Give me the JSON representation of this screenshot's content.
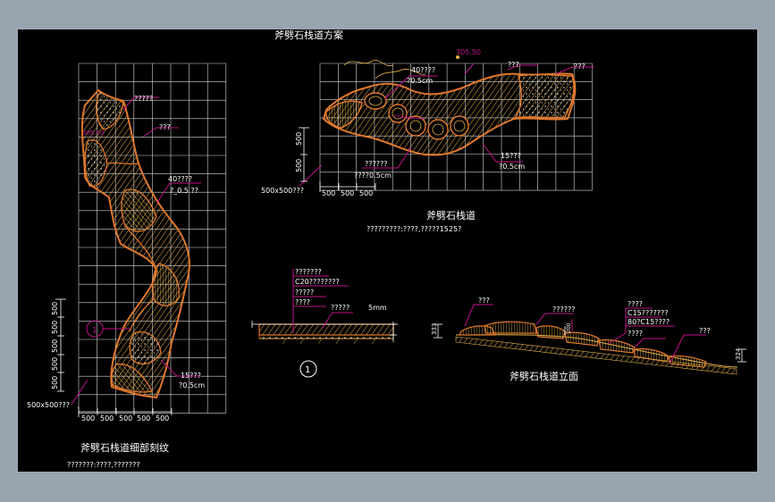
{
  "colors": {
    "background": "#000000",
    "frame": "#9aa4b1",
    "grid": "#d8d8d8",
    "stone": "#e0782e",
    "hatch": "#e8b44a",
    "leader": "#c0128a",
    "text": "#ffffff"
  },
  "plan": {
    "title": "斧劈石栈道方案",
    "subtitle": "斧劈石栈道",
    "note": "?????????:????,?????1525?",
    "label_top_coord": "305.50",
    "label_1": "40????",
    "label_1b": "?0.5cm",
    "label_2": "???",
    "label_3": "???",
    "label_4": "???",
    "label_5": "15???",
    "label_5b": "?0.5cm",
    "label_6": "??????",
    "label_6b": "????0.5cm",
    "grid_label": "500x500???",
    "dim_bottom": [
      "500",
      "500",
      "500"
    ],
    "dim_left": [
      "500",
      "500"
    ]
  },
  "detail": {
    "title": "斧劈石栈道细部刻纹",
    "note": "???????:????,???????",
    "label_a": "?????",
    "label_b": "???",
    "label_c": "40????",
    "label_c2": "?_0.5 ??",
    "label_d": "15???",
    "label_d2": "?0.5cm",
    "label_coord": "305.50",
    "grid_label": "500x500???",
    "dim_bottom": [
      "500",
      "500",
      "500",
      "500",
      "500"
    ],
    "dim_left": [
      "500",
      "500",
      "500",
      "500",
      "500"
    ],
    "marker": "1"
  },
  "section": {
    "marker": "1",
    "layers": [
      "???????",
      "C20????????",
      "?????",
      "????"
    ],
    "label_right": "?????",
    "dim": "5mm"
  },
  "elevation": {
    "title": "斧劈石栈道立面",
    "label_a": "???",
    "label_b": "??????",
    "label_c": "????",
    "label_d": "C15???????",
    "label_e": "80?C15????",
    "label_f": "????",
    "label_g": "???",
    "dim_left": "333",
    "dim_right": "324",
    "dim_mid": "200"
  }
}
